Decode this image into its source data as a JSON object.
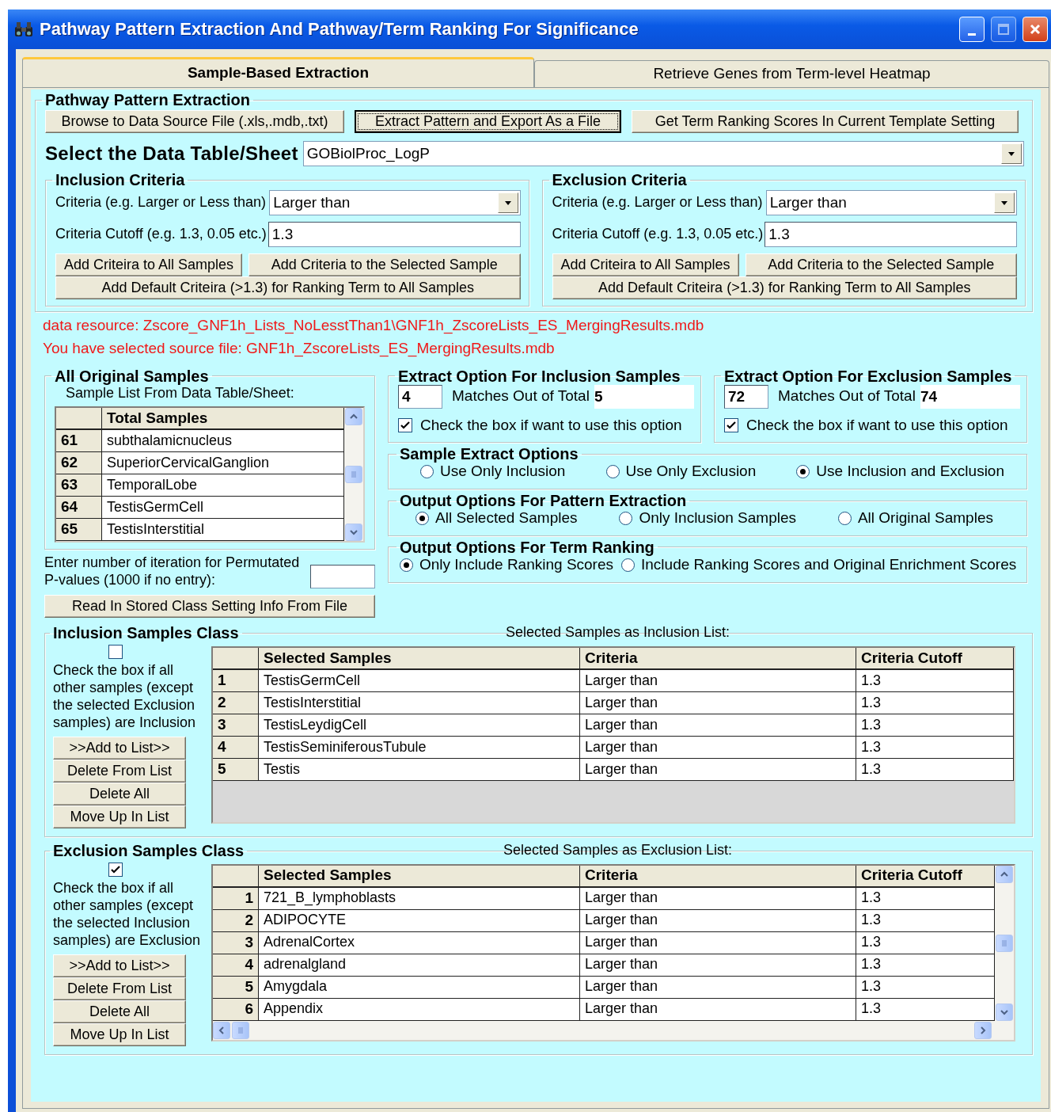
{
  "window": {
    "title": "Pathway Pattern Extraction And Pathway/Term Ranking For Significance"
  },
  "tabs": [
    {
      "label": "Sample-Based Extraction",
      "selected": true
    },
    {
      "label": "Retrieve Genes from Term-level Heatmap",
      "selected": false
    }
  ],
  "pattern_extraction": {
    "title": "Pathway Pattern Extraction",
    "buttons": [
      {
        "label": "Browse to Data Source File (.xls,.mdb,.txt)",
        "focused": false
      },
      {
        "label": "Extract Pattern and Export As a File",
        "focused": true
      },
      {
        "label": "Get Term Ranking Scores In Current Template Setting",
        "focused": false
      }
    ],
    "table_label": "Select the Data Table/Sheet",
    "table_value": "GOBiolProc_LogP"
  },
  "criteria": [
    {
      "title": "Inclusion Criteria",
      "criteria_label": "Criteria (e.g. Larger or Less  than)",
      "criteria_value": "Larger than",
      "cutoff_label": "Criteria Cutoff (e.g.  1.3, 0.05 etc.)",
      "cutoff_value": "1.3",
      "buttons": [
        "Add Criteira to All Samples",
        "Add Criteria to the Selected Sample",
        "Add Default Criteira (>1.3) for Ranking Term to All Samples"
      ]
    },
    {
      "title": "Exclusion Criteria",
      "criteria_label": "Criteria (e.g. Larger or Less  than)",
      "criteria_value": "Larger than",
      "cutoff_label": "Criteria Cutoff (e.g.  1.3, 0.05 etc.)",
      "cutoff_value": "1.3",
      "buttons": [
        "Add Criteira to All Samples",
        "Add Criteria to the Selected Sample",
        "Add Default Criteira (>1.3) for Ranking Term to All Samples"
      ]
    }
  ],
  "messages": [
    "data resource: Zscore_GNF1h_Lists_NoLesstThan1\\GNF1h_ZscoreLists_ES_MergingResults.mdb",
    "You have selected source file: GNF1h_ZscoreLists_ES_MergingResults.mdb"
  ],
  "original_samples": {
    "title": "All Original Samples",
    "caption": "Sample List From Data Table/Sheet:",
    "column": "Total Samples",
    "rows": [
      {
        "index": "61",
        "name": "subthalamicnucleus"
      },
      {
        "index": "62",
        "name": "SuperiorCervicalGanglion"
      },
      {
        "index": "63",
        "name": "TemporalLobe"
      },
      {
        "index": "64",
        "name": "TestisGermCell"
      },
      {
        "index": "65",
        "name": "TestisInterstitial"
      }
    ]
  },
  "iteration": {
    "label": "Enter number of iteration for Permutated P-values (1000  if no entry):"
  },
  "read_button": "Read In Stored Class Setting Info From File",
  "extract_options": [
    {
      "title": "Extract Option For Inclusion Samples",
      "matches": "4",
      "matches_label": "Matches Out of  Total",
      "total": "5",
      "checkbox_label": "Check the box if want to use this option",
      "checked": true
    },
    {
      "title": "Extract Option For Exclusion Samples",
      "matches": "72",
      "matches_label": "Matches Out of  Total",
      "total": "74",
      "checkbox_label": "Check the box if want to use this option",
      "checked": true
    }
  ],
  "radio_groups": [
    {
      "title": "Sample Extract Options",
      "options": [
        {
          "label": "Use Only Inclusion",
          "selected": false
        },
        {
          "label": "Use Only Exclusion",
          "selected": false
        },
        {
          "label": "Use Inclusion and Exclusion",
          "selected": true
        }
      ]
    },
    {
      "title": "Output Options For Pattern Extraction",
      "options": [
        {
          "label": "All Selected Samples",
          "selected": true
        },
        {
          "label": "Only Inclusion Samples",
          "selected": false
        },
        {
          "label": "All Original Samples",
          "selected": false
        }
      ]
    },
    {
      "title": "Output Options For Term Ranking",
      "options": [
        {
          "label": "Only Include Ranking Scores",
          "selected": true
        },
        {
          "label": "Include Ranking Scores and Original Enrichment Scores",
          "selected": false
        }
      ]
    }
  ],
  "sample_classes": [
    {
      "title": "Inclusion Samples Class",
      "checked": false,
      "check_label": "Check the box if all other samples (except the selected Exclusion samples) are Inclusion",
      "buttons": [
        ">>Add to List>>",
        "Delete From List",
        "Delete All",
        "Move Up In List"
      ],
      "list_caption": "Selected Samples as Inclusion List:",
      "columns": [
        "Selected Samples",
        "Criteria",
        "Criteria Cutoff"
      ],
      "rows": [
        {
          "index": "1",
          "sample": "TestisGermCell",
          "criteria": "Larger than",
          "cutoff": "1.3"
        },
        {
          "index": "2",
          "sample": "TestisInterstitial",
          "criteria": "Larger than",
          "cutoff": "1.3"
        },
        {
          "index": "3",
          "sample": "TestisLeydigCell",
          "criteria": "Larger than",
          "cutoff": "1.3"
        },
        {
          "index": "4",
          "sample": "TestisSeminiferousTubule",
          "criteria": "Larger than",
          "cutoff": "1.3"
        },
        {
          "index": "5",
          "sample": "Testis",
          "criteria": "Larger than",
          "cutoff": "1.3"
        }
      ]
    },
    {
      "title": "Exclusion Samples Class",
      "checked": true,
      "check_label": "Check the box if all other samples (except the selected Inclusion samples) are Exclusion",
      "buttons": [
        ">>Add to List>>",
        "Delete From List",
        "Delete All",
        "Move Up In List"
      ],
      "list_caption": "Selected Samples as Exclusion List:",
      "columns": [
        "Selected Samples",
        "Criteria",
        "Criteria Cutoff"
      ],
      "rows": [
        {
          "index": "1",
          "sample": "721_B_lymphoblasts",
          "criteria": "Larger than",
          "cutoff": "1.3"
        },
        {
          "index": "2",
          "sample": "ADIPOCYTE",
          "criteria": "Larger than",
          "cutoff": "1.3"
        },
        {
          "index": "3",
          "sample": "AdrenalCortex",
          "criteria": "Larger than",
          "cutoff": "1.3"
        },
        {
          "index": "4",
          "sample": "adrenalgland",
          "criteria": "Larger than",
          "cutoff": "1.3"
        },
        {
          "index": "5",
          "sample": "Amygdala",
          "criteria": "Larger than",
          "cutoff": "1.3"
        },
        {
          "index": "6",
          "sample": "Appendix",
          "criteria": "Larger than",
          "cutoff": "1.3"
        }
      ]
    }
  ]
}
